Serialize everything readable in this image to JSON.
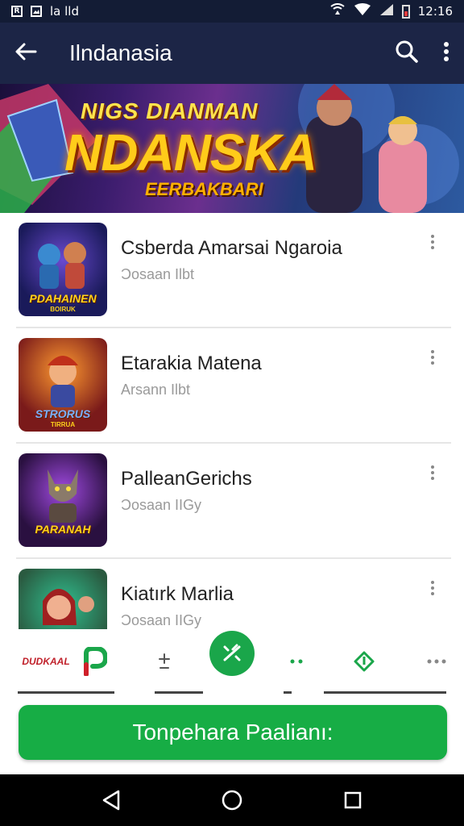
{
  "status_bar": {
    "left_icons": [
      "R",
      "image",
      "la",
      "lld"
    ],
    "left_text": "la lld",
    "time": "12:16",
    "icons": [
      "hotspot-icon",
      "wifi-icon",
      "signal-icon",
      "battery-icon"
    ],
    "battery_color": "#e03b3b"
  },
  "app_bar": {
    "title": "Ilndanasia",
    "back_icon": "arrow-left-icon",
    "search_icon": "search-icon",
    "menu_icon": "more-vertical-icon",
    "bg_color": "#1c2546"
  },
  "banner": {
    "top_text": "NIGS DIANMAN",
    "main_text": "NDANSKA",
    "sub_text": "EERBAKBARI"
  },
  "games": [
    {
      "name": "Csberda Amarsai Ngaroia",
      "meta": "Ͻosaan Ilbt",
      "thumb_label": "PDAHAINEN",
      "thumb_sub": "BOIRUK"
    },
    {
      "name": "Etarakia Matena",
      "meta": "Arsann Ilbt",
      "thumb_label": "STRORUS",
      "thumb_sub": "TIRRUA"
    },
    {
      "name": "PalleanGerichs",
      "meta": "Ͻosaan IIGy",
      "thumb_label": "PARANAH",
      "thumb_sub": ""
    },
    {
      "name": "Kiatırk Marlia",
      "meta": "Ͻosaan IIGy",
      "thumb_label": "",
      "thumb_sub": ""
    }
  ],
  "bottom_nav": {
    "logo_text": "DUDKAAL",
    "items": [
      "brand-logo",
      "p-icon",
      "plus-minus-icon",
      "fab-icon",
      "dots-icon",
      "diamond-icon",
      "more-icon"
    ],
    "accent": "#1aa64a"
  },
  "cta": {
    "label": "Tonpehara Paalianı:",
    "color": "#17ad45"
  },
  "system_nav": [
    "back-icon",
    "home-icon",
    "recents-icon"
  ]
}
